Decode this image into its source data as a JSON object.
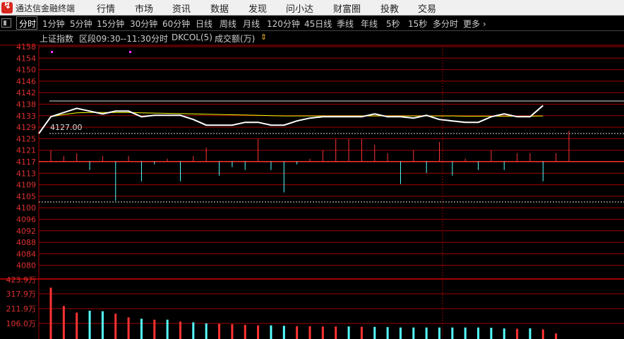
{
  "app": {
    "title": "通达信金融终端",
    "logo_icon": "tdx-logo-icon"
  },
  "menu": [
    "行情",
    "市场",
    "资讯",
    "数据",
    "发现",
    "问小达",
    "财富圈",
    "投教",
    "交易"
  ],
  "periods": [
    "分时",
    "1分钟",
    "5分钟",
    "15分钟",
    "30分钟",
    "60分钟",
    "日线",
    "周线",
    "月线",
    "120分钟",
    "45日线",
    "季线",
    "年线",
    "5秒",
    "15秒",
    "多分时",
    "更多"
  ],
  "active_period": "分时",
  "info": {
    "index_name": "上证指数",
    "range": "区段09:30--11:30",
    "mode": "分时",
    "indicator": "DKCOL(5)",
    "volume_label": "成交额(万)"
  },
  "colors": {
    "up": "#ff3232",
    "down": "#54ffff",
    "grid": "#a00000",
    "price_line": "#ffffff",
    "avg_line": "#ffff00"
  },
  "chart_data": {
    "type": "line",
    "title": "上证指数",
    "x_range": [
      "09:30",
      "11:30"
    ],
    "price_axis": {
      "ticks": [
        4158,
        4154,
        4150,
        4146,
        4142,
        4138,
        4133,
        4129,
        4125,
        4121,
        4117,
        4113,
        4109,
        4105,
        4100,
        4096,
        4092,
        4088,
        4084,
        4080
      ],
      "ylim": [
        4078,
        4160
      ]
    },
    "baseline_value": 4117,
    "price_annotation": "4127.00",
    "series": [
      {
        "values": [
          4127,
          4133,
          4134.5,
          4136,
          4135,
          4134,
          4135,
          4135,
          4133,
          4133.5,
          4133.5,
          4133.5,
          4132,
          4130,
          4130,
          4130,
          4131,
          4131,
          4130,
          4130,
          4131.5,
          4132.5,
          4133,
          4133,
          4133,
          4133,
          4134,
          4133,
          4133,
          4132.5,
          4133.5,
          4132,
          4131.5,
          4131,
          4131,
          4133,
          4134,
          4133,
          4133,
          4137
        ]
      },
      {
        "values": [
          4127,
          4133,
          4133.8,
          4134.4,
          4134.5,
          4134.5,
          4134.5,
          4134.5,
          4134.4,
          4134.3,
          4134.2,
          4134.1,
          4134,
          4133.9,
          4133.8,
          4133.7,
          4133.6,
          4133.5,
          4133.4,
          4133.3,
          4133.3,
          4133.3,
          4133.3,
          4133.3,
          4133.3,
          4133.3,
          4133.3,
          4133.3,
          4133.3,
          4133.3,
          4133.3,
          4133.3,
          4133.3,
          4133.2,
          4133.2,
          4133.2,
          4133.2,
          4133.2,
          4133.2,
          4133.3
        ]
      }
    ],
    "indicator_bars": [
      4121,
      4119,
      4120,
      4114,
      4119,
      4103,
      4119,
      4110,
      4116,
      4118,
      4110,
      4119,
      4122,
      4112,
      4115,
      4114,
      4125,
      4114,
      4106,
      4116,
      4118,
      4121,
      4125,
      4125,
      4125,
      4123,
      4120,
      4109,
      4121,
      4113,
      4124,
      4112,
      4118,
      4114,
      4121,
      4114,
      4120,
      4120,
      4110,
      4120,
      4128
    ],
    "volume": {
      "ticks": [
        "423.9万",
        "317.9万",
        "211.9万",
        "106.0万"
      ],
      "ylim": [
        0,
        445
      ],
      "values": [
        385,
        248,
        198,
        212,
        208,
        190,
        162,
        152,
        145,
        145,
        131,
        125,
        117,
        114,
        111,
        106,
        102,
        102,
        99,
        96,
        96,
        94,
        94,
        94,
        92,
        91,
        89,
        86,
        86,
        86,
        86,
        86,
        86,
        86,
        84,
        79,
        77,
        80,
        72,
        42
      ],
      "directions": [
        "up",
        "up",
        "up",
        "down",
        "down",
        "up",
        "up",
        "down",
        "up",
        "down",
        "up",
        "down",
        "down",
        "up",
        "up",
        "up",
        "up",
        "down",
        "down",
        "up",
        "up",
        "up",
        "up",
        "down",
        "up",
        "down",
        "down",
        "down",
        "down",
        "down",
        "down",
        "down",
        "down",
        "down",
        "down",
        "down",
        "up",
        "down",
        "up",
        "up"
      ]
    }
  }
}
